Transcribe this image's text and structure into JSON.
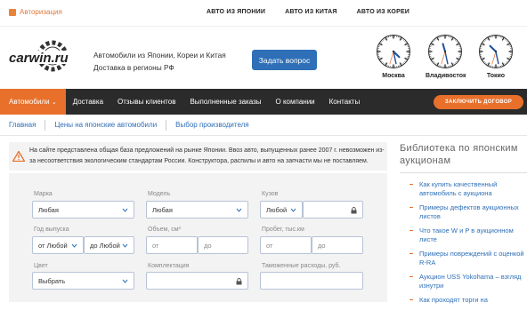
{
  "topbar": {
    "auth_label": "Авторизация",
    "links": [
      "АВТО ИЗ ЯПОНИИ",
      "АВТО ИЗ КИТАЯ",
      "АВТО ИЗ КОРЕИ"
    ]
  },
  "header": {
    "logo_text": "carwin.ru",
    "tagline": "Автомобили из Японии, Кореи и Китая Доставка в регионы РФ",
    "ask_button": "Задать вопрос",
    "clocks": [
      {
        "city": "Москва",
        "hour": 4,
        "minute": 28
      },
      {
        "city": "Владивосток",
        "hour": 11,
        "minute": 28
      },
      {
        "city": "Токио",
        "hour": 10,
        "minute": 28
      }
    ]
  },
  "nav": {
    "items": [
      "Автомобили",
      "Доставка",
      "Отзывы клиентов",
      "Выполненные заказы",
      "О компании",
      "Контакты"
    ],
    "contract_button": "ЗАКЛЮЧИТЬ ДОГОВОР"
  },
  "breadcrumb": [
    "Главная",
    "Цены на японские автомобили",
    "Выбор производителя"
  ],
  "notice": "На сайте представлена общая база предложений на рынке Японии. Ввоз авто, выпущенных ранее 2007 г. невозможен из-за несоответствия экологическим стандартам России. Конструктора, распилы и авто на запчасти мы не поставляем.",
  "form": {
    "make_label": "Марка",
    "make_value": "Любая",
    "model_label": "Модель",
    "model_value": "Любая",
    "body_label": "Кузов",
    "body_value": "Любой",
    "year_label": "Год выпуска",
    "year_from": "от Любой",
    "year_to": "до Любой",
    "volume_label": "Объем, см³",
    "volume_from": "от",
    "volume_to": "до",
    "mileage_label": "Пробег, тыс.км",
    "mileage_from": "от",
    "mileage_to": "до",
    "color_label": "Цвет",
    "color_value": "Выбрать",
    "trim_label": "Комплектация",
    "customs_label": "Таможенные расходы, руб."
  },
  "sidebar": {
    "title": "Библиотека по японским аукционам",
    "links": [
      "Как купить качественный автомобиль с аукциона",
      "Примеры дефектов аукционных листов",
      "Что такое W и P в аукционном листе",
      "Примеры повреждений с оценкой R-RA",
      "Аукцион USS Yokohama – взгляд изнутри",
      "Как проходят торги на"
    ]
  },
  "colors": {
    "accent": "#e8702a",
    "primary": "#2e6fb7",
    "nav_bg": "#2b2b2b"
  }
}
